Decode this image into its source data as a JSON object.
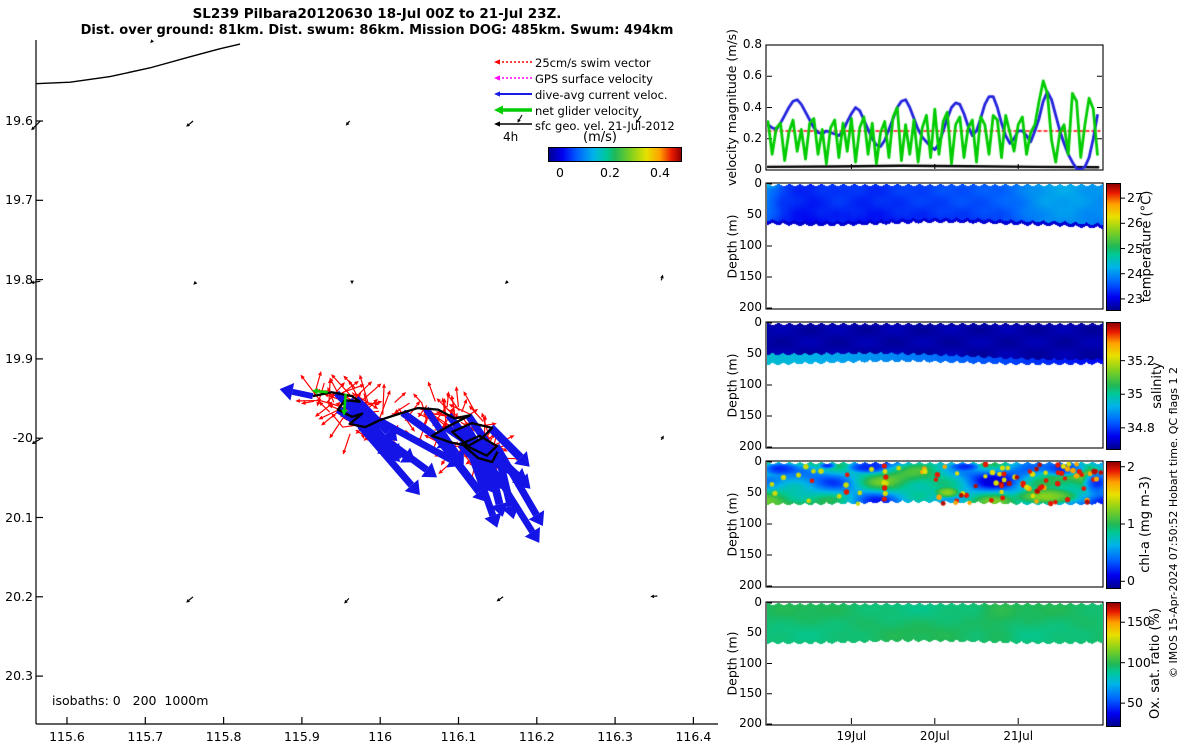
{
  "title": {
    "line1": "SL239 Pilbara20120630 18-Jul 00Z to 21-Jul 23Z.",
    "line2": "Dist. over ground: 81km. Dist. swum: 86km. Mission DOG: 485km. Swum: 494km"
  },
  "attribution": "© IMOS 15-Apr-2024 07:50:52 Hobart time. QC flags 1 2",
  "chart_data": [
    {
      "id": "map",
      "type": "map",
      "x_tick_labels": [
        "115.6",
        "115.7",
        "115.8",
        "115.9",
        "116",
        "116.1",
        "116.2",
        "116.3",
        "116.4"
      ],
      "x_tick_lons": [
        115.6,
        115.7,
        115.8,
        115.9,
        116.0,
        116.1,
        116.2,
        116.3,
        116.4
      ],
      "y_tick_labels": [
        "19.6",
        "19.7",
        "19.8",
        "19.9",
        "-20",
        "20.1",
        "20.2",
        "20.3"
      ],
      "y_tick_lats": [
        19.6,
        19.7,
        19.8,
        19.9,
        20.0,
        20.1,
        20.2,
        20.3
      ],
      "xlim": [
        115.56,
        116.48
      ],
      "ylim": [
        19.497,
        20.36
      ],
      "isobaths_label": "isobaths: 0   200  1000m",
      "coastline": [
        [
          115.56,
          19.553
        ],
        [
          115.604,
          19.551
        ],
        [
          115.655,
          19.544
        ],
        [
          115.706,
          19.533
        ],
        [
          115.757,
          19.519
        ],
        [
          115.795,
          19.509
        ],
        [
          115.821,
          19.503
        ]
      ],
      "grid_arrows": [
        [
          115.709,
          19.499,
          135,
          3
        ],
        [
          115.566,
          19.6,
          135,
          13
        ],
        [
          115.761,
          19.6,
          140,
          9
        ],
        [
          115.961,
          19.6,
          130,
          6
        ],
        [
          115.566,
          19.802,
          170,
          10
        ],
        [
          115.765,
          19.803,
          135,
          4
        ],
        [
          115.964,
          19.802,
          90,
          3
        ],
        [
          116.163,
          19.802,
          135,
          4
        ],
        [
          116.359,
          19.801,
          285,
          6
        ],
        [
          115.566,
          20.001,
          150,
          10
        ],
        [
          116.359,
          20.002,
          300,
          5
        ],
        [
          115.761,
          20.2,
          140,
          9
        ],
        [
          115.96,
          20.202,
          132,
          7
        ],
        [
          116.157,
          20.2,
          145,
          8
        ],
        [
          116.354,
          20.199,
          175,
          7
        ]
      ],
      "track": [
        [
          115.914,
          19.947
        ],
        [
          115.938,
          19.942
        ],
        [
          115.964,
          19.947
        ],
        [
          115.974,
          19.954
        ],
        [
          115.955,
          19.952
        ],
        [
          115.946,
          19.964
        ],
        [
          115.964,
          19.973
        ],
        [
          115.977,
          19.969
        ],
        [
          115.961,
          19.982
        ],
        [
          115.981,
          19.986
        ],
        [
          116.0,
          19.977
        ],
        [
          116.025,
          19.969
        ],
        [
          116.048,
          19.962
        ],
        [
          116.074,
          19.964
        ],
        [
          116.095,
          19.975
        ],
        [
          116.115,
          19.971
        ],
        [
          116.087,
          19.985
        ],
        [
          116.066,
          19.997
        ],
        [
          116.089,
          20.005
        ],
        [
          116.112,
          20.01
        ],
        [
          116.13,
          20.0
        ],
        [
          116.143,
          19.987
        ],
        [
          116.117,
          19.981
        ],
        [
          116.092,
          19.992
        ],
        [
          116.115,
          20.012
        ],
        [
          116.136,
          20.022
        ],
        [
          116.149,
          20.01
        ],
        [
          116.127,
          19.997
        ],
        [
          116.104,
          20.007
        ],
        [
          116.125,
          20.025
        ],
        [
          116.143,
          20.03
        ],
        [
          116.15,
          20.017
        ]
      ],
      "green_arrows": [
        [
          115.956,
          19.944,
          95,
          22
        ],
        [
          115.933,
          19.942,
          185,
          16
        ]
      ],
      "swim_vectors": {
        "count": 150,
        "seed": 11,
        "len_min": 13,
        "len_max": 32,
        "jitter": 11,
        "color": "#FF0000"
      },
      "dive_avg_vectors": {
        "count": 26,
        "seed": 5,
        "len_min": 55,
        "len_max": 105,
        "color": "#1414E6"
      },
      "track_color": "#000000",
      "legend": {
        "items": [
          {
            "label": "25cm/s swim vector",
            "color": "#FF0000",
            "width": 1.4,
            "dash": "2,2"
          },
          {
            "label": "GPS surface velocity",
            "color": "#FF00FF",
            "width": 1.4,
            "dash": "2,2"
          },
          {
            "label": "dive-avg current veloc.",
            "color": "#1A1AE6",
            "width": 2,
            "dash": ""
          },
          {
            "label": "net glider velocity",
            "color": "#00CC00",
            "width": 3.5,
            "dash": ""
          },
          {
            "label": "sfc geo. vel. 21-Jul-2012",
            "color": "#000000",
            "width": 1.6,
            "dash": ""
          }
        ],
        "duration_label": "4h",
        "sample_arrows": [
          [
            522,
            115,
            120,
            9
          ],
          [
            641,
            116,
            125,
            9
          ]
        ]
      },
      "colorbar": {
        "title": "(m/s)",
        "tick_labels": [
          "0",
          "0.2",
          "0.4"
        ],
        "tick_values": [
          0,
          0.2,
          0.4
        ],
        "range": [
          -0.048,
          0.48
        ]
      }
    },
    {
      "id": "velocity",
      "type": "line",
      "ylabel": "velocity magnitude (m/s)",
      "ylim": [
        0,
        0.8
      ],
      "ytick_values": [
        0,
        0.2,
        0.4,
        0.6,
        0.8
      ],
      "ytick_labels": [
        "0",
        "0.2",
        "0.4",
        "0.6",
        "0.8"
      ],
      "x_range_days": [
        0,
        4.01
      ],
      "step_days": 0.05,
      "series": [
        {
          "name": "dive-avg current velocity",
          "color": "#2222DD",
          "width": 2.8,
          "values": [
            0.29,
            0.27,
            0.26,
            0.3,
            0.35,
            0.4,
            0.44,
            0.45,
            0.42,
            0.37,
            0.32,
            0.27,
            0.24,
            0.23,
            0.25,
            0.24,
            0.23,
            0.22,
            0.25,
            0.31,
            0.36,
            0.4,
            0.38,
            0.32,
            0.26,
            0.2,
            0.16,
            0.15,
            0.19,
            0.26,
            0.33,
            0.4,
            0.44,
            0.45,
            0.4,
            0.33,
            0.26,
            0.21,
            0.18,
            0.15,
            0.13,
            0.17,
            0.25,
            0.33,
            0.4,
            0.43,
            0.42,
            0.36,
            0.28,
            0.22,
            0.25,
            0.33,
            0.42,
            0.47,
            0.47,
            0.4,
            0.3,
            0.22,
            0.17,
            0.2,
            0.25,
            0.25,
            0.22,
            0.18,
            0.25,
            0.33,
            0.44,
            0.5,
            0.45,
            0.35,
            0.25,
            0.17,
            0.1,
            0.05,
            0.01,
            0.0,
            0.02,
            0.08,
            0.2,
            0.35
          ]
        },
        {
          "name": "net glider velocity",
          "color": "#00CC00",
          "width": 2.8,
          "values": [
            0.31,
            0.1,
            0.27,
            0.3,
            0.06,
            0.24,
            0.32,
            0.12,
            0.26,
            0.07,
            0.3,
            0.33,
            0.1,
            0.26,
            0.04,
            0.27,
            0.32,
            0.08,
            0.3,
            0.12,
            0.33,
            0.05,
            0.27,
            0.34,
            0.1,
            0.3,
            0.04,
            0.24,
            0.31,
            0.08,
            0.34,
            0.4,
            0.06,
            0.29,
            0.1,
            0.32,
            0.05,
            0.27,
            0.35,
            0.08,
            0.39,
            0.1,
            0.31,
            0.37,
            0.04,
            0.29,
            0.34,
            0.08,
            0.27,
            0.32,
            0.05,
            0.34,
            0.29,
            0.1,
            0.35,
            0.32,
            0.08,
            0.35,
            0.24,
            0.12,
            0.29,
            0.34,
            0.1,
            0.24,
            0.29,
            0.44,
            0.57,
            0.49,
            0.19,
            0.05,
            0.24,
            0.29,
            0.1,
            0.49,
            0.44,
            0.08,
            0.29,
            0.46,
            0.39,
            0.1
          ]
        },
        {
          "name": "25cm/s swim speed",
          "color": "#FF0000",
          "width": 1.5,
          "style": "dashed",
          "constant": 0.25
        },
        {
          "name": "sfc geostrophic velocity",
          "color": "#000000",
          "width": 2.4,
          "points": [
            [
              0,
              0.02
            ],
            [
              0.8,
              0.022
            ],
            [
              1.6,
              0.027
            ],
            [
              2.4,
              0.024
            ],
            [
              3.2,
              0.02
            ],
            [
              3.96,
              0.018
            ]
          ]
        }
      ]
    },
    {
      "id": "temperature",
      "type": "heatmap",
      "ylabel": "Depth (m)",
      "depth_tick_labels": [
        "0",
        "50",
        "100",
        "150",
        "200"
      ],
      "depth_tick_values": [
        0,
        50,
        100,
        150,
        200
      ],
      "band": {
        "base_depth_m": 62,
        "surface_values_by_time": [
          23.9,
          23.5,
          23.35,
          23.3,
          23.4,
          23.45,
          23.4,
          23.35,
          23.4,
          23.45,
          23.5,
          23.5,
          23.55,
          23.6,
          23.6,
          23.65,
          23.7,
          23.8,
          24.0,
          24.15,
          24.2,
          24.2,
          24.1,
          24.05
        ],
        "bottom_value": 22.95
      },
      "colorbar": {
        "title": "temperature (°C)",
        "tick_labels": [
          "23",
          "24",
          "25",
          "26",
          "27"
        ],
        "tick_values": [
          23,
          24,
          25,
          26,
          27
        ],
        "range": [
          22.6,
          27.6
        ]
      }
    },
    {
      "id": "salinity",
      "type": "heatmap",
      "ylabel": "Depth (m)",
      "depth_tick_labels": [
        "0",
        "50",
        "100",
        "150",
        "200"
      ],
      "depth_tick_values": [
        0,
        50,
        100,
        150,
        200
      ],
      "band": {
        "base_depth_m": 62,
        "base_value": 34.7,
        "bottom_strip_left_value": 34.96,
        "bottom_strip_right_value": 34.76,
        "strip_thickness_left_px": 10,
        "strip_thickness_right_px": 4
      },
      "colorbar": {
        "title": "salinity",
        "tick_labels": [
          "34.8",
          "35",
          "35.2"
        ],
        "tick_values": [
          34.8,
          35.0,
          35.2
        ],
        "range": [
          34.68,
          35.43
        ]
      }
    },
    {
      "id": "chl",
      "type": "heatmap",
      "ylabel": "Depth (m)",
      "depth_tick_labels": [
        "0",
        "50",
        "100",
        "150",
        "200"
      ],
      "depth_tick_values": [
        0,
        50,
        100,
        150,
        200
      ],
      "band": {
        "base_depth_m": 64,
        "background_mean": 0.72,
        "low_patch_value": 0.22,
        "bright_patch_value": 1.3,
        "dot_values": {
          "yellow": 1.5,
          "orange": 1.72,
          "red": 1.95,
          "dark_red": 2.03
        },
        "dots_seed": 23,
        "dots_count_right": 70,
        "dots_count_left": 18
      },
      "colorbar": {
        "title": "chl-a (mg m-3)",
        "tick_labels": [
          "0",
          "1",
          "2"
        ],
        "tick_values": [
          0,
          1,
          2
        ],
        "range": [
          -0.1,
          2.1
        ]
      }
    },
    {
      "id": "oxygen",
      "type": "heatmap",
      "ylabel": "Depth (m)",
      "depth_tick_labels": [
        "0",
        "50",
        "100",
        "150",
        "200"
      ],
      "depth_tick_values": [
        0,
        50,
        100,
        150,
        200
      ],
      "band": {
        "base_depth_m": 61,
        "base_value": 96
      },
      "colorbar": {
        "title": "Ox. sat. ratio (%)",
        "tick_labels": [
          "50",
          "100",
          "150"
        ],
        "tick_values": [
          50,
          100,
          150
        ],
        "range": [
          23,
          175
        ]
      },
      "date_ticks": [
        {
          "day": 1,
          "label": "19Jul"
        },
        {
          "day": 2,
          "label": "20Jul"
        },
        {
          "day": 3,
          "label": "21Jul"
        }
      ]
    }
  ]
}
